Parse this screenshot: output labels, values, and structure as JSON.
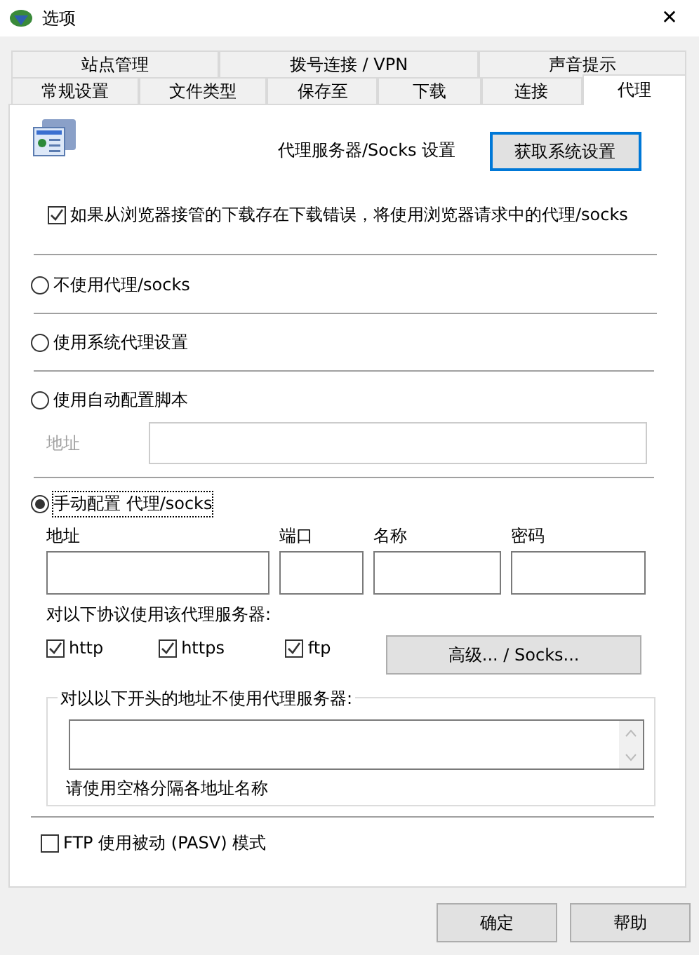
{
  "window": {
    "title": "选项",
    "close": "✕"
  },
  "tab_rows": [
    [
      {
        "label": "站点管理",
        "selected": false
      },
      {
        "label": "拨号连接 / VPN",
        "selected": false
      },
      {
        "label": "声音提示",
        "selected": false
      }
    ],
    [
      {
        "label": "常规设置",
        "selected": false
      },
      {
        "label": "文件类型",
        "selected": false
      },
      {
        "label": "保存至",
        "selected": false
      },
      {
        "label": "下载",
        "selected": false
      },
      {
        "label": "连接",
        "selected": false
      },
      {
        "label": "代理",
        "selected": true
      }
    ]
  ],
  "heading": "代理服务器/Socks 设置",
  "get_system_button": {
    "label": "获取系统设置",
    "focused": true
  },
  "browser_proxy_checkbox": {
    "label": "如果从浏览器接管的下载存在下载错误，将使用浏览器请求中的代理/socks",
    "checked": true
  },
  "modes": [
    {
      "label": "不使用代理/socks",
      "selected": false
    },
    {
      "label": "使用系统代理设置",
      "selected": false
    },
    {
      "label": "使用自动配置脚本",
      "selected": false
    },
    {
      "label": "手动配置 代理/socks",
      "selected": true
    }
  ],
  "script_address": {
    "label": "地址",
    "disabled": true
  },
  "manual_fields": [
    {
      "label": "地址"
    },
    {
      "label": "端口"
    },
    {
      "label": "名称"
    },
    {
      "label": "密码"
    }
  ],
  "protocols_label": "对以下协议使用该代理服务器:",
  "protocols": [
    {
      "label": "http",
      "checked": true
    },
    {
      "label": "https",
      "checked": true
    },
    {
      "label": "ftp",
      "checked": true
    }
  ],
  "advanced_button": "高级... / Socks...",
  "bypass": {
    "legend": "对以以下开头的地址不使用代理服务器:",
    "hint": "请使用空格分隔各地址名称"
  },
  "pasv_checkbox": {
    "label": "FTP 使用被动 (PASV) 模式",
    "checked": false
  },
  "buttons": [
    "确定",
    "帮助"
  ]
}
